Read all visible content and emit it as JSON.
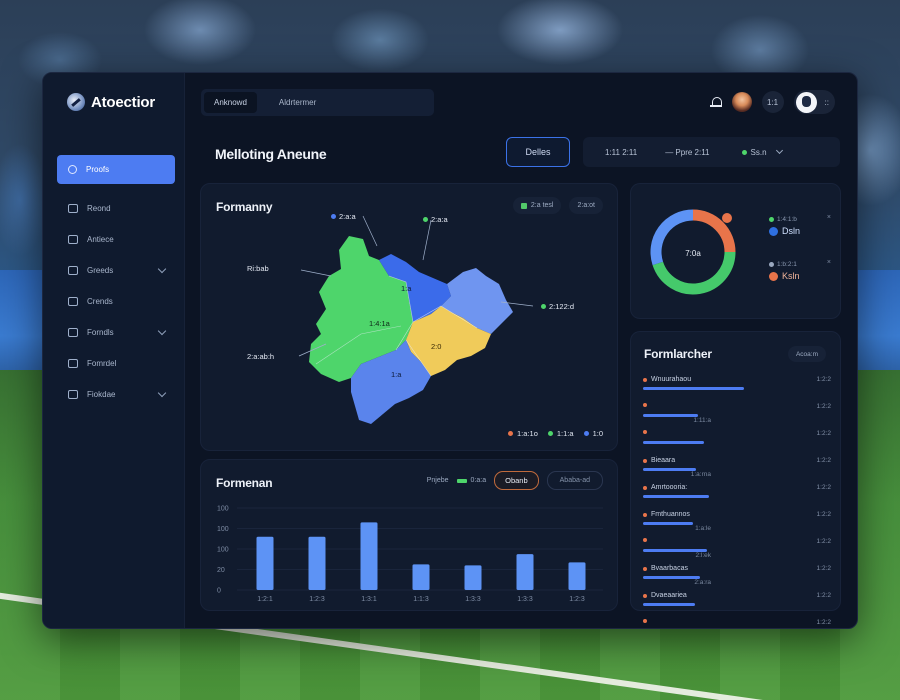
{
  "brand": {
    "name": "Atoectior"
  },
  "sidebar": {
    "items": [
      {
        "label": "Proofs",
        "active": true,
        "chevron": false
      },
      {
        "label": "Reond",
        "chevron": false
      },
      {
        "label": "Antiece",
        "chevron": false
      },
      {
        "label": "Greeds",
        "chevron": true
      },
      {
        "label": "Crends",
        "chevron": false
      },
      {
        "label": "Forndls",
        "chevron": true
      },
      {
        "label": "Fomrdel",
        "chevron": false
      },
      {
        "label": "Fiokdae",
        "chevron": true
      }
    ]
  },
  "topbar": {
    "tabs": [
      "Anknowd",
      "Aldrtermer"
    ],
    "notif_badge": "1:1",
    "user_text": "::"
  },
  "header": {
    "title": "Melloting Aneune",
    "select_label": "Delles",
    "filters": {
      "date": "1:11 2:11",
      "range": "— Ppre 2:11",
      "live": "Ss.n"
    }
  },
  "map_card": {
    "title": "Formanny",
    "chips": [
      {
        "label": "2:a tesl",
        "color": "#52c96a"
      },
      {
        "label": "2:a:ot",
        "color": "#2a3650"
      }
    ],
    "labels": [
      {
        "text": "2:a:a",
        "dot": "#4d7cf2"
      },
      {
        "text": "2:a:a",
        "dot": "#4ed56b"
      },
      {
        "text": "Ri:bab",
        "dot": ""
      },
      {
        "text": "2:122:d",
        "dot": "#4ed56b"
      },
      {
        "text": "2:a:ab:h",
        "dot": ""
      },
      {
        "text": "1:4:1a",
        "dot": ""
      },
      {
        "text": "1:a",
        "dot": ""
      },
      {
        "text": "2:0",
        "dot": ""
      },
      {
        "text": "1:a",
        "dot": ""
      }
    ],
    "legend": [
      {
        "text": "1:a:1o",
        "color": "#e8744a"
      },
      {
        "text": "1:1:a",
        "color": "#4ed56b"
      },
      {
        "text": "1:0",
        "color": "#4d7cf2"
      }
    ]
  },
  "donut_card": {
    "center": "7:0a",
    "ring": [
      {
        "value": 25,
        "color": "#e8744a"
      },
      {
        "value": 45,
        "color": "#45c96b"
      },
      {
        "value": 30,
        "color": "#5d93f5"
      }
    ],
    "legend": [
      {
        "name": "1:4:1:b",
        "value": "Dsln",
        "color": "#5d93f5"
      },
      {
        "name": "1:b:2:1",
        "value": "Ksln",
        "color": "#e8744a"
      }
    ]
  },
  "list_card": {
    "title": "Formlarcher",
    "action": "Acoa:m",
    "items": [
      {
        "name": "Wnuurahaou",
        "value": "1:2:2",
        "bar": 0.92,
        "sub": ""
      },
      {
        "name": "",
        "value": "1:2:2",
        "bar": 0.5,
        "sub": "1:11:a"
      },
      {
        "name": "",
        "value": "1:2:2",
        "bar": 0.55,
        "sub": ""
      },
      {
        "name": "Bieaara",
        "value": "1:2:2",
        "bar": 0.48,
        "sub": "1:a:rna"
      },
      {
        "name": "Amrtoooria:",
        "value": "1:2:2",
        "bar": 0.6,
        "sub": ""
      },
      {
        "name": "Fmthuannos",
        "value": "1:2:2",
        "bar": 0.45,
        "sub": "1:a:le"
      },
      {
        "name": "",
        "value": "1:2:2",
        "bar": 0.58,
        "sub": "2:l:ek"
      },
      {
        "name": "Bvaarbacas",
        "value": "1:2:2",
        "bar": 0.52,
        "sub": "2:a:ra"
      },
      {
        "name": "Dvaeaariea",
        "value": "1:2:2",
        "bar": 0.47,
        "sub": ""
      },
      {
        "name": "",
        "value": "1:2:2",
        "bar": 0.62,
        "sub": ""
      }
    ]
  },
  "bar_card": {
    "title": "Formenan",
    "controls": {
      "label": "Pnjebe",
      "legend": "0:a:a",
      "button": "Obanb",
      "button2": "Ababa-ad"
    },
    "chart_data": {
      "type": "bar",
      "categories": [
        "1:2:1",
        "1:2:3",
        "1:3:1",
        "1:1:3",
        "1:3:3",
        "1:3:3",
        "1:2:3"
      ],
      "values": [
        52,
        52,
        66,
        25,
        24,
        35,
        27
      ],
      "yticks": [
        "100",
        "100",
        "100",
        "20",
        "0"
      ],
      "ylim": [
        0,
        80
      ],
      "color": "#5d93f5"
    }
  }
}
